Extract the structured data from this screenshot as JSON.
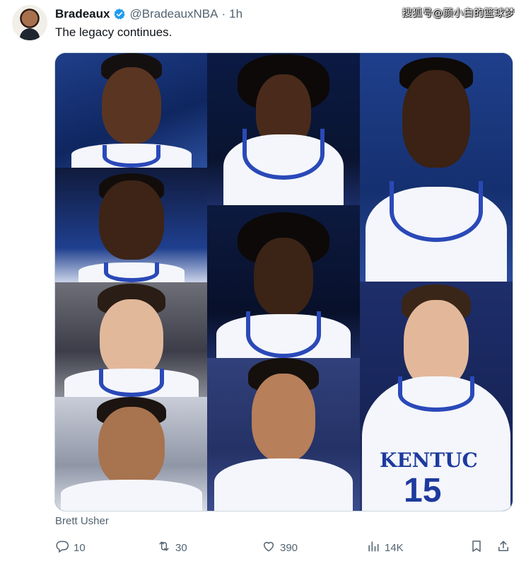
{
  "author": {
    "name": "Bradeaux",
    "handle": "@BradeauxNBA",
    "separator": "·",
    "time": "1h"
  },
  "tweet": {
    "text": "The legacy continues."
  },
  "watermark": "搜狐号@颜小白的篮球梦",
  "media": {
    "credit": "Brett Usher",
    "jersey_text": "KENTUC",
    "jersey_number": "15",
    "photo_count": 10
  },
  "actions": {
    "reply": {
      "count": "10",
      "icon": "reply-icon"
    },
    "retweet": {
      "count": "30",
      "icon": "retweet-icon"
    },
    "like": {
      "count": "390",
      "icon": "heart-icon"
    },
    "views": {
      "count": "14K",
      "icon": "analytics-icon"
    },
    "bookmark": {
      "icon": "bookmark-icon"
    },
    "share": {
      "icon": "share-icon"
    }
  },
  "colors": {
    "verified": "#1d9bf0",
    "secondary_text": "#536471",
    "kentucky_blue": "#2a49b8"
  }
}
